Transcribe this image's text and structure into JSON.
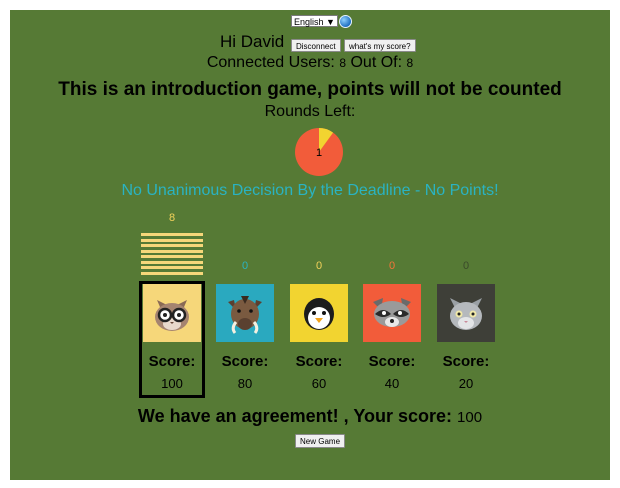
{
  "language": {
    "selected": "English ▼"
  },
  "header": {
    "greeting": "Hi David",
    "disconnect_label": "Disconnect",
    "score_label": "what's my score?",
    "connected_prefix": "Connected Users:",
    "connected_count": "8",
    "out_of_prefix": "Out Of:",
    "out_of_count": "8",
    "intro_notice": "This is an introduction game, points will not be counted",
    "rounds_prefix": "Rounds Left:",
    "rounds_left": "1",
    "rounds_fraction_remaining": 0.9
  },
  "status": {
    "no_unanimous": "No Unanimous Decision By the Deadline - No Points!"
  },
  "players": [
    {
      "animal": "cat-with-glasses",
      "votes": "8",
      "vote_color": "#f2d25a",
      "bar_count": 8,
      "bg": "#f6d77a",
      "score_label": "Score:",
      "score": "100",
      "selected": true
    },
    {
      "animal": "warthog",
      "votes": "0",
      "vote_color": "#2ab3c2",
      "bar_count": 0,
      "bg": "#2aa9bf",
      "score_label": "Score:",
      "score": "80",
      "selected": false
    },
    {
      "animal": "penguin",
      "votes": "0",
      "vote_color": "#f2d25a",
      "bar_count": 0,
      "bg": "#f2d430",
      "score_label": "Score:",
      "score": "60",
      "selected": false
    },
    {
      "animal": "raccoon",
      "votes": "0",
      "vote_color": "#f5743a",
      "bar_count": 0,
      "bg": "#f25c3a",
      "score_label": "Score:",
      "score": "40",
      "selected": false
    },
    {
      "animal": "grey-cat",
      "votes": "0",
      "vote_color": "#3a4a2a",
      "bar_count": 0,
      "bg": "#3e3f38",
      "score_label": "Score:",
      "score": "20",
      "selected": false
    }
  ],
  "result": {
    "agreement_text": "We have an agreement! , Your score:",
    "your_score": "100",
    "new_game_label": "New Game"
  }
}
